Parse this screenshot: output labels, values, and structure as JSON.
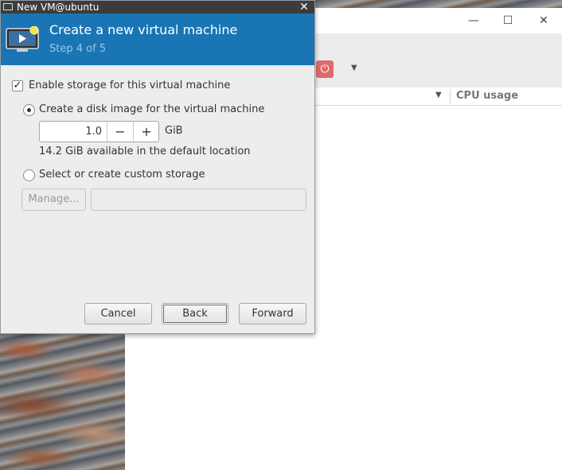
{
  "manager": {
    "columns": {
      "cpu_usage": "CPU usage"
    },
    "window_controls": {
      "minimize": "—",
      "maximize": "☐",
      "close": "✕"
    }
  },
  "dialog": {
    "window_title": "New VM@ubuntu",
    "close_glyph": "✕",
    "banner": {
      "title": "Create a new virtual machine",
      "step": "Step 4 of 5"
    },
    "enable_storage": {
      "label": "Enable storage for this virtual machine",
      "checked": true
    },
    "options": {
      "disk_image": {
        "label": "Create a disk image for the virtual machine",
        "selected": true
      },
      "custom_storage": {
        "label": "Select or create custom storage",
        "selected": false
      }
    },
    "size": {
      "value": "1.0",
      "unit": "GiB",
      "minus": "−",
      "plus": "+"
    },
    "available_text": "14.2 GiB available in the default location",
    "manage_button": "Manage...",
    "custom_path_value": "",
    "buttons": {
      "cancel": "Cancel",
      "back": "Back",
      "forward": "Forward"
    }
  },
  "colors": {
    "banner": "#1a75b5",
    "banner_step": "#9cc6e6",
    "power": "#e06a6a"
  }
}
